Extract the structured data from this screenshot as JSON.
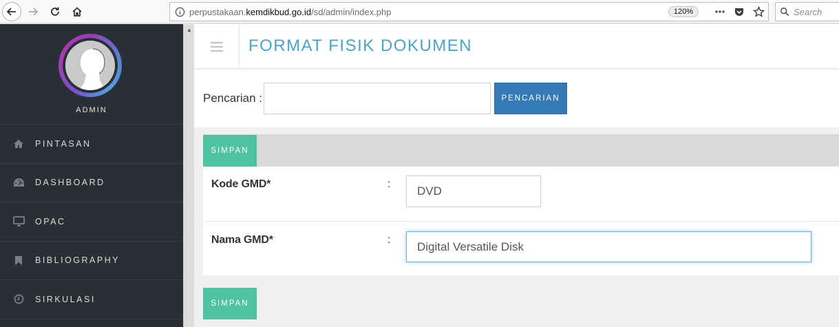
{
  "browser": {
    "url_prefix": "perpustakaan.",
    "url_domain": "kemdikbud.go.id",
    "url_path": "/sd/admin/index.php",
    "zoom": "120%",
    "search_placeholder": "Search"
  },
  "sidebar": {
    "user_label": "ADMIN",
    "items": [
      {
        "label": "PINTASAN",
        "icon": "home-icon"
      },
      {
        "label": "DASHBOARD",
        "icon": "dashboard-icon"
      },
      {
        "label": "OPAC",
        "icon": "monitor-icon"
      },
      {
        "label": "BIBLIOGRAPHY",
        "icon": "bookmark-icon"
      },
      {
        "label": "SIRKULASI",
        "icon": "clock-icon"
      }
    ]
  },
  "header": {
    "title": "FORMAT FISIK DOKUMEN"
  },
  "search": {
    "label": "Pencarian :",
    "value": "",
    "button_label": "PENCARIAN"
  },
  "form": {
    "save_label_top": "SIMPAN",
    "save_label_bottom": "SIMPAN",
    "fields": [
      {
        "label": "Kode GMD*",
        "colon": ":",
        "value": "DVD"
      },
      {
        "label": "Nama GMD*",
        "colon": ":",
        "value": "Digital Versatile Disk"
      }
    ]
  },
  "colors": {
    "sidebar_bg": "#2a2f35",
    "title_color": "#4ba3c7",
    "primary_button": "#337ab7",
    "save_button": "#4fc3a0"
  }
}
